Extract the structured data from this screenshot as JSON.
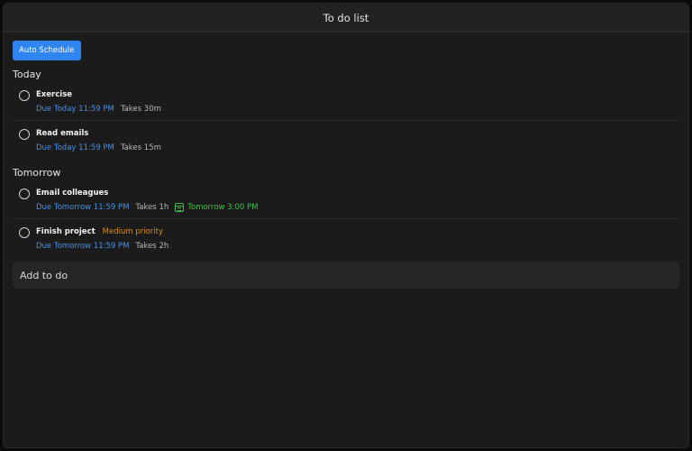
{
  "window": {
    "title": "To do list"
  },
  "toolbar": {
    "auto_schedule_label": "Auto Schedule"
  },
  "sections": [
    {
      "header": "Today",
      "tasks": [
        {
          "name": "Exercise",
          "due": "Due Today 11:59 PM",
          "takes": "Takes 30m"
        },
        {
          "name": "Read emails",
          "due": "Due Today 11:59 PM",
          "takes": "Takes 15m"
        }
      ]
    },
    {
      "header": "Tomorrow",
      "tasks": [
        {
          "name": "Email colleagues",
          "due": "Due Tomorrow 11:59 PM",
          "takes": "Takes 1h",
          "scheduled": "Tomorrow 3:00 PM"
        },
        {
          "name": "Finish project",
          "priority": "Medium priority",
          "due": "Due Tomorrow 11:59 PM",
          "takes": "Takes 2h"
        }
      ]
    }
  ],
  "add": {
    "placeholder": "Add to do"
  },
  "colors": {
    "accent": "#2f86f0",
    "due": "#4a90e2",
    "scheduled": "#3fbf4a",
    "priority": "#d98c18"
  }
}
